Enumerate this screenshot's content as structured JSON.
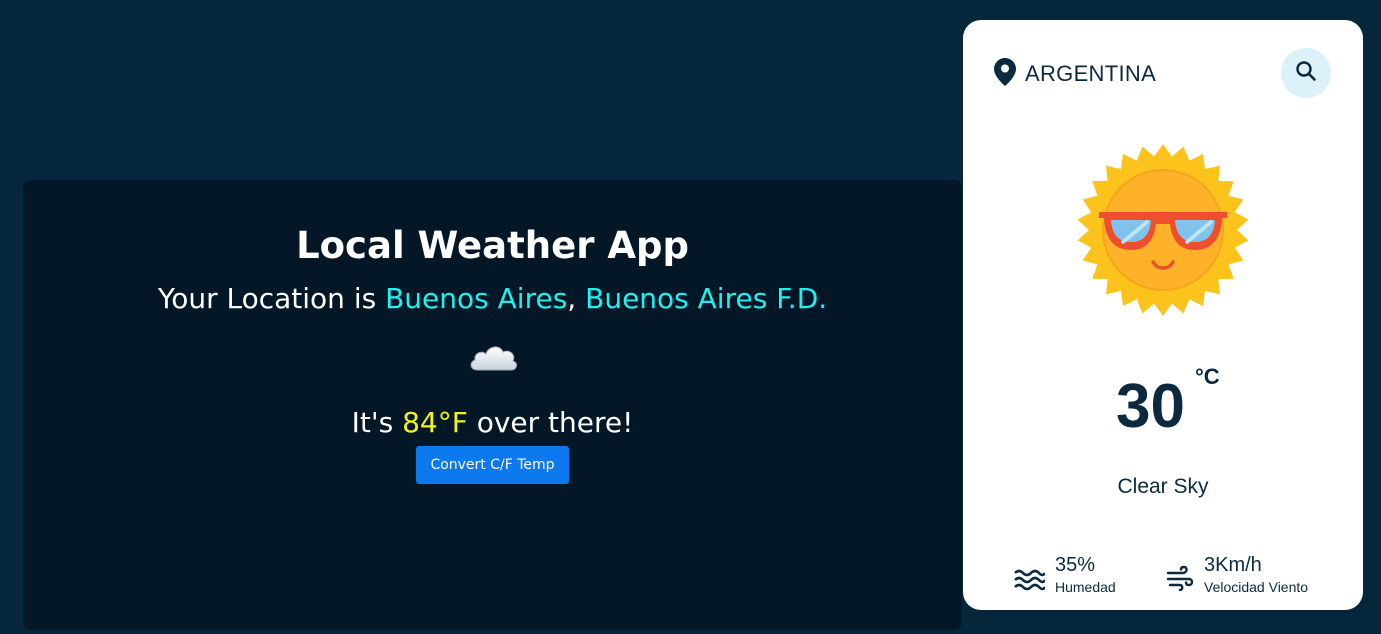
{
  "app": {
    "title": "Local Weather App",
    "location_prefix": "Your Location is ",
    "city": "Buenos Aires",
    "separator": ",",
    "region": "Buenos Aires F.D.",
    "temp_prefix": "It's ",
    "temp_value": "84°F",
    "temp_suffix": " over there!",
    "convert_button": "Convert C/F Temp",
    "condition_icon": "cloud-icon"
  },
  "widget": {
    "country": "ARGENTINA",
    "temperature": "30",
    "unit": "°C",
    "condition": "Clear Sky",
    "weather_icon": "sun-with-sunglasses-icon",
    "humidity": {
      "value": "35%",
      "label": "Humedad",
      "icon": "waves-icon"
    },
    "wind": {
      "value": "3Km/h",
      "label": "Velocidad Viento",
      "icon": "wind-icon"
    }
  },
  "colors": {
    "page_background": "#06263c",
    "card_background": "#041726",
    "accent_cyan": "#1ff0f0",
    "accent_yellow": "#f3f31a",
    "button_blue": "#0d79ef",
    "widget_text": "#0b2a3f"
  }
}
